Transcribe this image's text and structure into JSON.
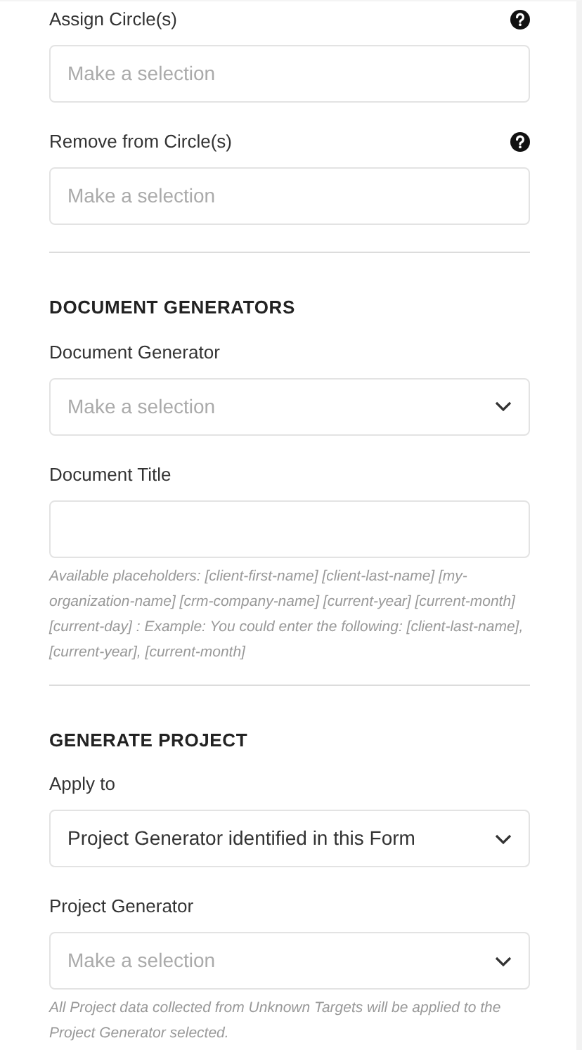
{
  "sections": [
    {
      "fields": [
        {
          "label": "Assign Circle(s)",
          "kind": "multiselect",
          "placeholder": "Make a selection",
          "help_icon": true
        },
        {
          "label": "Remove from Circle(s)",
          "kind": "multiselect",
          "placeholder": "Make a selection",
          "help_icon": true
        }
      ]
    },
    {
      "heading": "DOCUMENT GENERATORS",
      "fields": [
        {
          "label": "Document Generator",
          "kind": "select",
          "placeholder": "Make a selection",
          "help_icon": false
        },
        {
          "label": "Document Title",
          "kind": "text",
          "help_icon": false,
          "note": "Available placeholders: [client-first-name]  [client-last-name]  [my-organization-name]  [crm-company-name]  [current-year]  [current-month]  [current-day] : Example: You could enter the following: [client-last-name], [current-year], [current-month]"
        }
      ]
    },
    {
      "heading": "GENERATE PROJECT",
      "fields": [
        {
          "label": "Apply to",
          "kind": "select",
          "value": "Project Generator identified in this Form",
          "help_icon": false
        },
        {
          "label": "Project Generator",
          "kind": "select",
          "placeholder": "Make a selection",
          "help_icon": false,
          "note": "All Project data collected from Unknown Targets will be applied to the Project Generator selected."
        }
      ]
    }
  ]
}
